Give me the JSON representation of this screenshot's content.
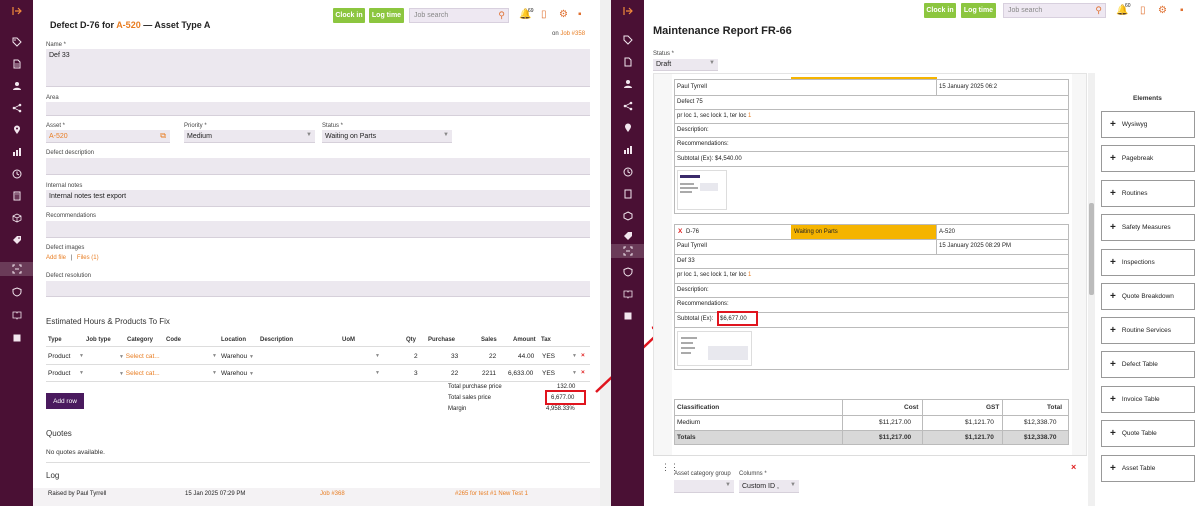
{
  "toolbar": {
    "clock_in": "Clock in",
    "log_time": "Log time",
    "search_placeholder": "Job search",
    "notif_count_left": "69",
    "notif_count_right": "60"
  },
  "left": {
    "title_prefix": "Defect D-76 for ",
    "title_asset_link": "A-520",
    "title_suffix": " — Asset Type A",
    "on_text": "on ",
    "on_job": "Job #358",
    "fields": {
      "name_label": "Name *",
      "name_value": "Def 33",
      "area_label": "Area",
      "asset_label": "Asset *",
      "asset_value": "A-520",
      "priority_label": "Priority *",
      "priority_value": "Medium",
      "status_label": "Status *",
      "status_value": "Waiting on Parts",
      "defect_description_label": "Defect description",
      "internal_notes_label": "Internal notes",
      "internal_notes_value": "Internal notes test export",
      "recommendations_label": "Recommendations",
      "defect_images_label": "Defect images",
      "add_file": "Add file",
      "files_sep": "|",
      "files": "Files (1)",
      "defect_resolution_label": "Defect resolution"
    },
    "hours_section_title": "Estimated Hours & Products To Fix",
    "table_headers": [
      "Type",
      "Job type",
      "Category",
      "Code",
      "Location",
      "Description",
      "UoM",
      "Qty",
      "Purchase",
      "Sales",
      "Amount",
      "Tax"
    ],
    "rows": [
      {
        "type": "Product",
        "category": "Select cat...",
        "location": "Warehou",
        "qty": "2",
        "purchase": "33",
        "sales": "22",
        "amount": "44.00",
        "tax": "YES"
      },
      {
        "type": "Product",
        "category": "Select cat...",
        "location": "Warehou",
        "qty": "3",
        "purchase": "22",
        "sales": "2211",
        "amount": "6,633.00",
        "tax": "YES"
      }
    ],
    "add_row": "Add row",
    "totals": {
      "purchase_label": "Total purchase price",
      "purchase_value": "132.00",
      "sales_label": "Total sales price",
      "sales_value": "6,677.00",
      "margin_label": "Margin",
      "margin_value": "4,958.33%"
    },
    "quotes_title": "Quotes",
    "quotes_empty": "No quotes available.",
    "log_title": "Log",
    "log_row": {
      "raised": "Raised by Paul Tyrrell",
      "date": "15 Jan 2025 07:29 PM",
      "job": "Job #368",
      "link": "#265 for test #1 New Test 1"
    }
  },
  "right": {
    "title": "Maintenance Report FR-66",
    "status_label": "Status *",
    "status_value": "Draft",
    "card1": {
      "name": "Paul Tyrrell",
      "date": "15 January 2025 06:2",
      "defect": "Defect 75",
      "loc_prefix": "pr loc 1, sec lock 1, ter loc ",
      "loc_link": "1",
      "description": "Description:",
      "recommendations": "Recommendations:",
      "subtotal": "Subtotal (Ex): $4,540.00"
    },
    "card2": {
      "x": "X",
      "defect_id": "D-76",
      "status": "Waiting on Parts",
      "asset": "A-520",
      "name": "Paul Tyrrell",
      "date": "15 January 2025 08:29 PM",
      "defect": "Def 33",
      "loc_prefix": "pr loc 1, sec lock 1, ter loc ",
      "loc_link": "1",
      "description": "Description:",
      "recommendations": "Recommendations:",
      "subtotal_label": "Subtotal (Ex):",
      "subtotal_value": "$6,677.00"
    },
    "class_table": {
      "headers": [
        "Classification",
        "Cost",
        "GST",
        "Total"
      ],
      "row": [
        "Medium",
        "$11,217.00",
        "$1,121.70",
        "$12,338.70"
      ],
      "totals": [
        "Totals",
        "$11,217.00",
        "$1,121.70",
        "$12,338.70"
      ]
    },
    "asset_cat_label": "Asset category group",
    "columns_label": "Columns *",
    "columns_value": "Custom ID ,",
    "elements_title": "Elements",
    "elements": [
      "Wysiwyg",
      "Pagebreak",
      "Routines",
      "Safety Measures",
      "Inspections",
      "Quote Breakdown",
      "Routine Services",
      "Defect Table",
      "Invoice Table",
      "Quote Table",
      "Asset Table"
    ]
  },
  "colors": {
    "sidebar": "#4a1034",
    "accent_green": "#8cc63f",
    "accent_orange": "#e87d22",
    "highlight_red": "#e0141e",
    "status_yellow": "#f5b400"
  }
}
